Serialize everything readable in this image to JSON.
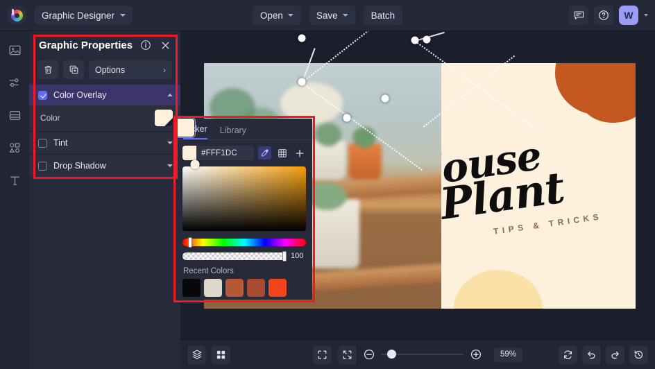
{
  "topbar": {
    "logo_icon": "color-wheel-logo",
    "document_name": "Graphic Designer",
    "buttons": [
      {
        "label": "Open",
        "has_caret": true
      },
      {
        "label": "Save",
        "has_caret": true
      },
      {
        "label": "Batch",
        "has_caret": false
      }
    ],
    "right_icons": [
      {
        "name": "chat-icon"
      },
      {
        "name": "help-icon"
      }
    ],
    "avatar_initial": "W"
  },
  "rail": {
    "items": [
      {
        "name": "image-icon"
      },
      {
        "name": "adjustments-icon"
      },
      {
        "name": "layers-icon"
      },
      {
        "name": "shapes-icon"
      },
      {
        "name": "text-icon"
      }
    ]
  },
  "properties_panel": {
    "title": "Graphic Properties",
    "info_icon": "info-icon",
    "close_icon": "close-icon",
    "delete_icon": "trash-icon",
    "duplicate_icon": "duplicate-icon",
    "options_label": "Options",
    "effects": [
      {
        "label": "Color Overlay",
        "checked": true,
        "expanded": true
      },
      {
        "label": "Tint",
        "checked": false,
        "expanded": false
      },
      {
        "label": "Drop Shadow",
        "checked": false,
        "expanded": false
      }
    ],
    "color_row_label": "Color",
    "color_swatch_hex": "#FFF1DC"
  },
  "color_picker": {
    "tabs": [
      {
        "label": "Picker",
        "active": true
      },
      {
        "label": "Library",
        "active": false
      }
    ],
    "hex_value": "#FFF1DC",
    "tool_icons": [
      {
        "name": "eyedropper-icon",
        "selected": true
      },
      {
        "name": "palette-grid-icon",
        "selected": false
      },
      {
        "name": "add-icon",
        "selected": false
      }
    ],
    "alpha_value": "100",
    "recent_colors_label": "Recent Colors",
    "recent_colors": [
      {
        "hex": "#FFF1DC",
        "selected": true
      },
      {
        "hex": "#080808",
        "selected": false
      },
      {
        "hex": "#DCD7C8",
        "selected": false
      },
      {
        "hex": "#B55838",
        "selected": false
      },
      {
        "hex": "#A74A30",
        "selected": false
      },
      {
        "hex": "#F1441A",
        "selected": false
      }
    ]
  },
  "canvas": {
    "design_title_line1": "House",
    "design_title_line2": "Plant",
    "design_subtitle": "TIPS & TRICKS",
    "accent_orange": "#C4561F",
    "cream_background": "#FDF0DC",
    "selection_handles": 6
  },
  "bottombar": {
    "left_icons": [
      {
        "name": "layers-stack-icon"
      },
      {
        "name": "grid-view-icon"
      }
    ],
    "view_icons": [
      {
        "name": "fit-screen-icon"
      },
      {
        "name": "shrink-icon"
      }
    ],
    "zoom_out_icon": "zoom-out-icon",
    "zoom_in_icon": "zoom-in-icon",
    "zoom_level": "59%",
    "right_icons": [
      {
        "name": "reset-icon"
      },
      {
        "name": "undo-icon"
      },
      {
        "name": "redo-icon"
      },
      {
        "name": "history-icon"
      }
    ]
  }
}
